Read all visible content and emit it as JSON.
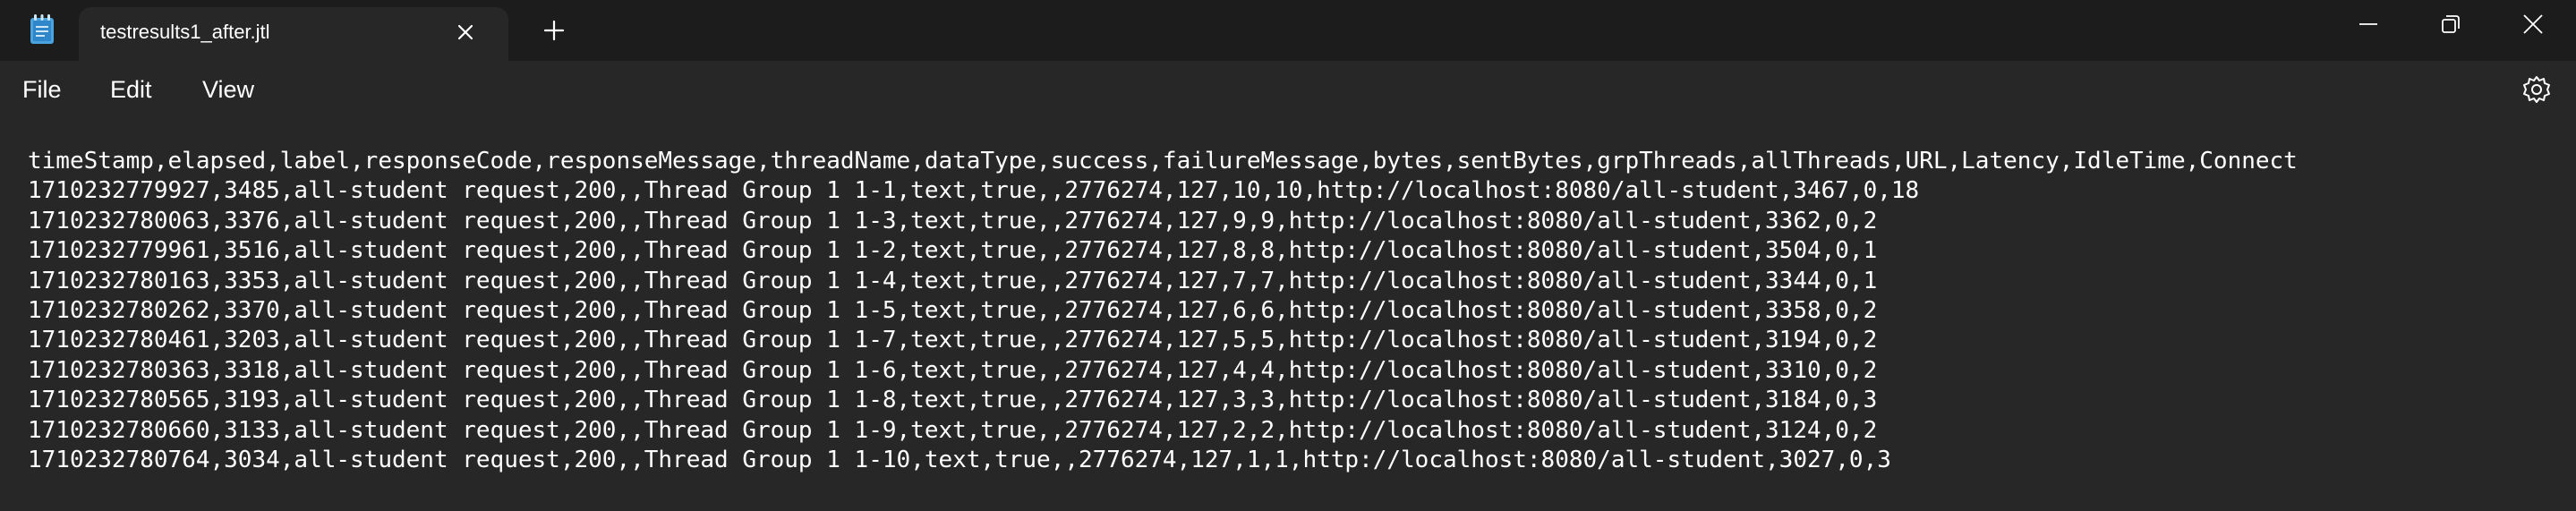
{
  "tab": {
    "title": "testresults1_after.jtl"
  },
  "menu": {
    "file": "File",
    "edit": "Edit",
    "view": "View"
  },
  "icons": {
    "app": "notepad-icon",
    "close_tab": "close-icon",
    "new_tab": "plus-icon",
    "minimize": "minimize-icon",
    "maximize": "restore-icon",
    "close_window": "close-icon",
    "settings": "gear-icon"
  },
  "colors": {
    "background": "#272727",
    "titlebar": "#1c1c1c",
    "text": "#ffffff",
    "app_icon": "#4aa3df"
  },
  "content": {
    "lines": [
      "timeStamp,elapsed,label,responseCode,responseMessage,threadName,dataType,success,failureMessage,bytes,sentBytes,grpThreads,allThreads,URL,Latency,IdleTime,Connect",
      "1710232779927,3485,all-student request,200,,Thread Group 1 1-1,text,true,,2776274,127,10,10,http://localhost:8080/all-student,3467,0,18",
      "1710232780063,3376,all-student request,200,,Thread Group 1 1-3,text,true,,2776274,127,9,9,http://localhost:8080/all-student,3362,0,2",
      "1710232779961,3516,all-student request,200,,Thread Group 1 1-2,text,true,,2776274,127,8,8,http://localhost:8080/all-student,3504,0,1",
      "1710232780163,3353,all-student request,200,,Thread Group 1 1-4,text,true,,2776274,127,7,7,http://localhost:8080/all-student,3344,0,1",
      "1710232780262,3370,all-student request,200,,Thread Group 1 1-5,text,true,,2776274,127,6,6,http://localhost:8080/all-student,3358,0,2",
      "1710232780461,3203,all-student request,200,,Thread Group 1 1-7,text,true,,2776274,127,5,5,http://localhost:8080/all-student,3194,0,2",
      "1710232780363,3318,all-student request,200,,Thread Group 1 1-6,text,true,,2776274,127,4,4,http://localhost:8080/all-student,3310,0,2",
      "1710232780565,3193,all-student request,200,,Thread Group 1 1-8,text,true,,2776274,127,3,3,http://localhost:8080/all-student,3184,0,3",
      "1710232780660,3133,all-student request,200,,Thread Group 1 1-9,text,true,,2776274,127,2,2,http://localhost:8080/all-student,3124,0,2",
      "1710232780764,3034,all-student request,200,,Thread Group 1 1-10,text,true,,2776274,127,1,1,http://localhost:8080/all-student,3027,0,3"
    ]
  }
}
